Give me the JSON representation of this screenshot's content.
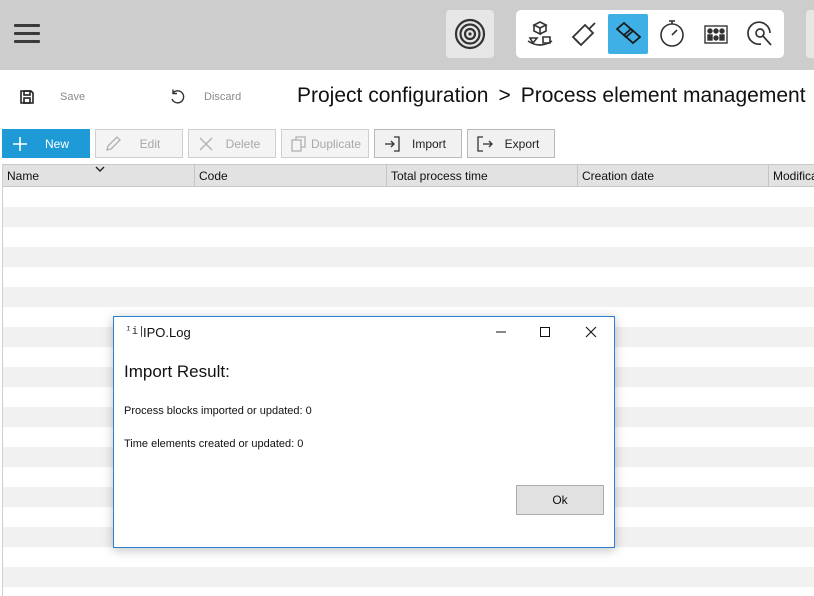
{
  "toolbar": {
    "save_label": "Save",
    "discard_label": "Discard",
    "actions": {
      "new": "New",
      "edit": "Edit",
      "delete": "Delete",
      "duplicate": "Duplicate",
      "import": "Import",
      "export": "Export"
    }
  },
  "breadcrumb": {
    "parent": "Project configuration",
    "separator": ">",
    "current": "Process element management"
  },
  "grid": {
    "columns": [
      "Name",
      "Code",
      "Total process time",
      "Creation date",
      "Modification date"
    ],
    "sorted_column": "Name"
  },
  "dialog": {
    "app_icon_text": "ᴵi|",
    "title": "IPO.Log",
    "heading": "Import Result:",
    "lines": [
      "Process blocks imported or updated: 0",
      "Time elements created or updated: 0"
    ],
    "ok_label": "Ok"
  },
  "colors": {
    "accent": "#1e9bd7",
    "active_tool": "#3fb0e6",
    "topbar": "#cdcdcd"
  }
}
